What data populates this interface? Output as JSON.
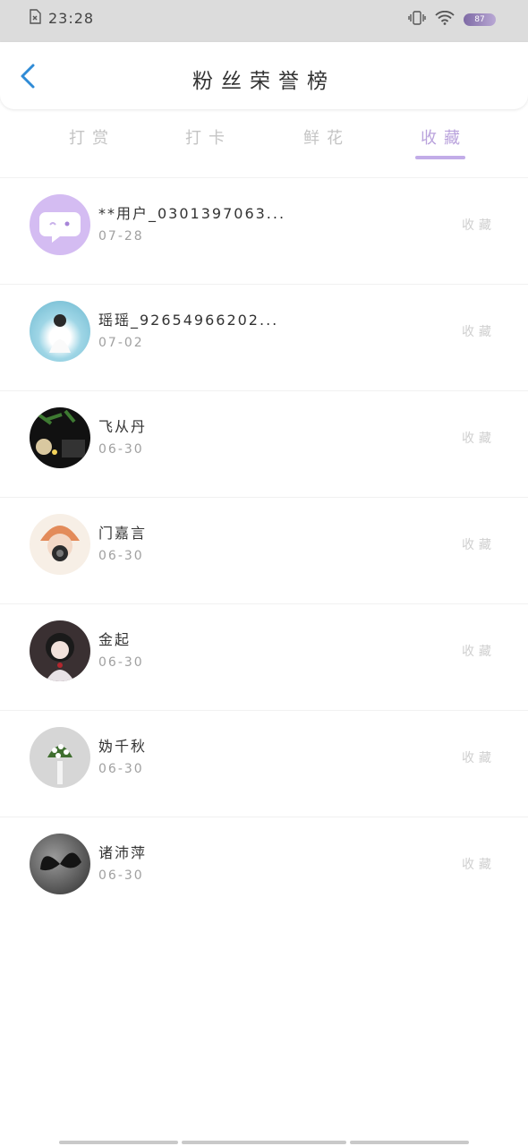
{
  "status_bar": {
    "time": "23:28",
    "battery": "87"
  },
  "header": {
    "title": "粉丝荣誉榜"
  },
  "tabs": [
    {
      "label": "打赏",
      "active": false
    },
    {
      "label": "打卡",
      "active": false
    },
    {
      "label": "鲜花",
      "active": false
    },
    {
      "label": "收藏",
      "active": true
    }
  ],
  "colors": {
    "accent": "#c2ace8",
    "back_arrow": "#2f8bd6"
  },
  "fans": [
    {
      "name": "**用户_0301397063...",
      "date": "07-28",
      "action": "收藏",
      "avatar": "chat-bubble-avatar"
    },
    {
      "name": "瑶瑶_92654966202...",
      "date": "07-02",
      "action": "收藏",
      "avatar": "photo-avatar"
    },
    {
      "name": "飞从丹",
      "date": "06-30",
      "action": "收藏",
      "avatar": "photo-avatar"
    },
    {
      "name": "门嘉言",
      "date": "06-30",
      "action": "收藏",
      "avatar": "photo-avatar"
    },
    {
      "name": "金起",
      "date": "06-30",
      "action": "收藏",
      "avatar": "photo-avatar"
    },
    {
      "name": "妫千秋",
      "date": "06-30",
      "action": "收藏",
      "avatar": "photo-avatar"
    },
    {
      "name": "诸沛萍",
      "date": "06-30",
      "action": "收藏",
      "avatar": "photo-avatar"
    }
  ]
}
